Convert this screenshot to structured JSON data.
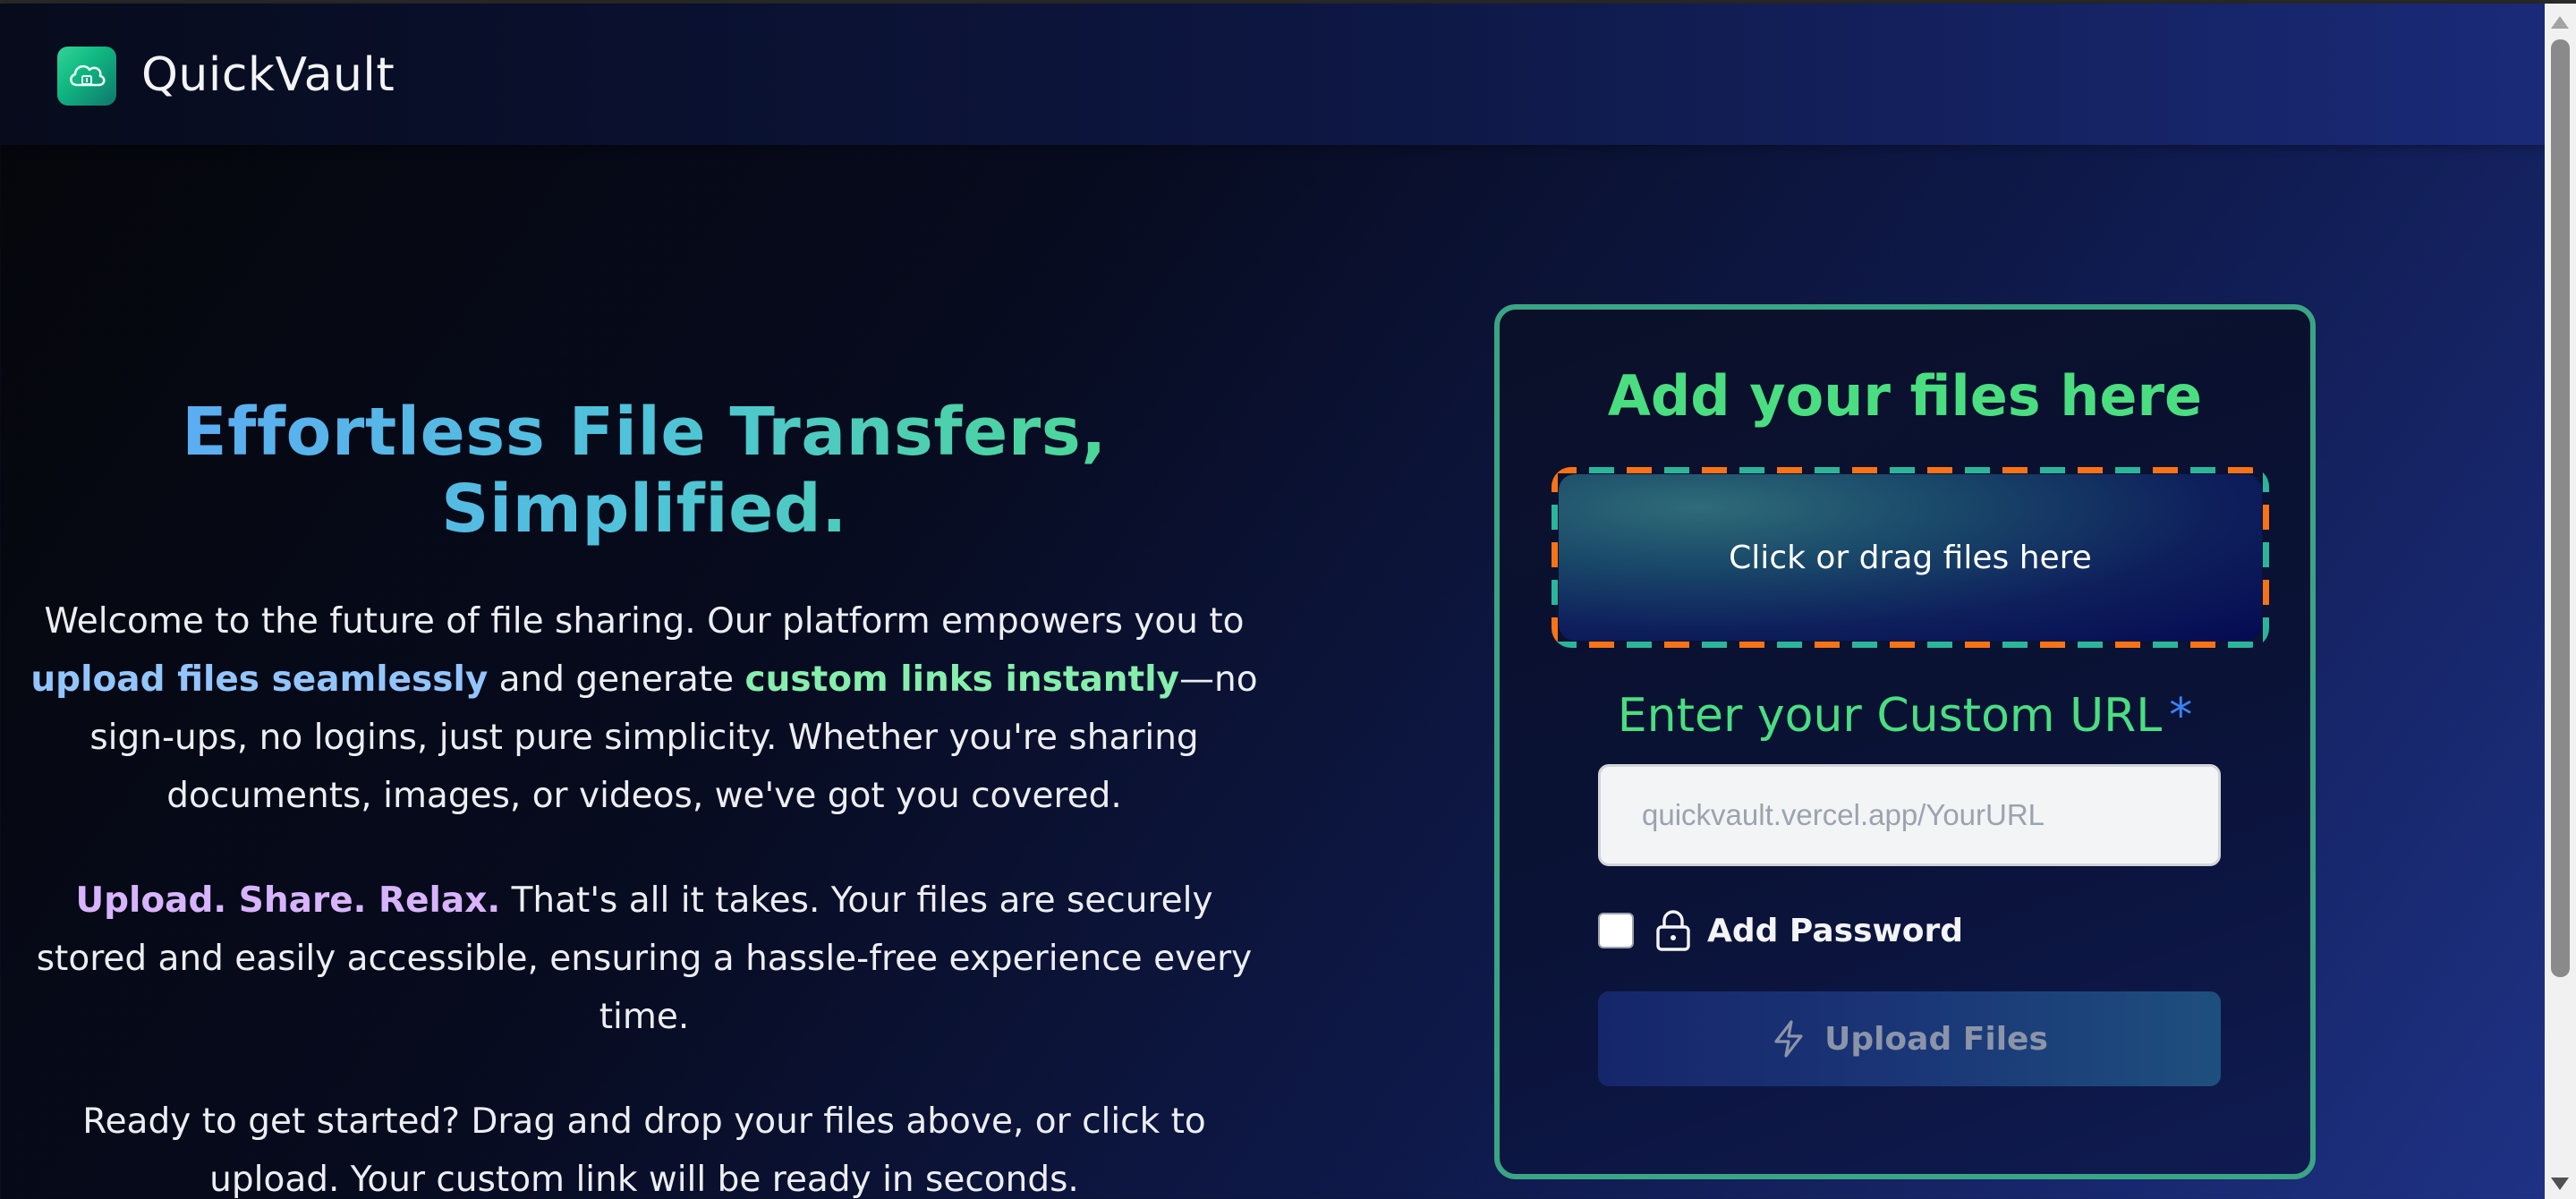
{
  "brand": {
    "name": "QuickVault",
    "logo_icon": "cloud-upload-icon",
    "logo_colors": [
      "#34d399",
      "#0f766e"
    ]
  },
  "hero": {
    "title": "Effortless File Transfers, Simplified.",
    "paragraph1": {
      "text_a": "Welcome to the future of file sharing. Our platform empowers you to ",
      "highlight_a": "upload files seamlessly",
      "text_b": " and generate ",
      "highlight_b": "custom links instantly",
      "text_c": "—no sign-ups, no logins, just pure simplicity. Whether you're sharing documents, images, or videos, we've got you covered."
    },
    "paragraph2": {
      "highlight": "Upload. Share. Relax.",
      "text": " That's all it takes. Your files are securely stored and easily accessible, ensuring a hassle-free experience every time."
    },
    "paragraph3": "Ready to get started? Drag and drop your files above, or click to upload. Your custom link will be ready in seconds."
  },
  "upload_card": {
    "title": "Add your files here",
    "dropzone_text": "Click or drag files here",
    "url_label": "Enter your Custom URL",
    "url_required_mark": "*",
    "url_value": "",
    "url_placeholder": "quickvault.vercel.app/YourURL",
    "password_checked": false,
    "password_label": "Add Password",
    "password_icon": "lock-icon",
    "upload_button_label": "Upload Files",
    "upload_button_icon": "bolt-icon"
  },
  "colors": {
    "accent_green": "#4ade80",
    "accent_blue": "#60a5fa",
    "card_border": "#3aa584",
    "dash_orange": "#f97316",
    "dash_teal": "#2bb59a"
  }
}
